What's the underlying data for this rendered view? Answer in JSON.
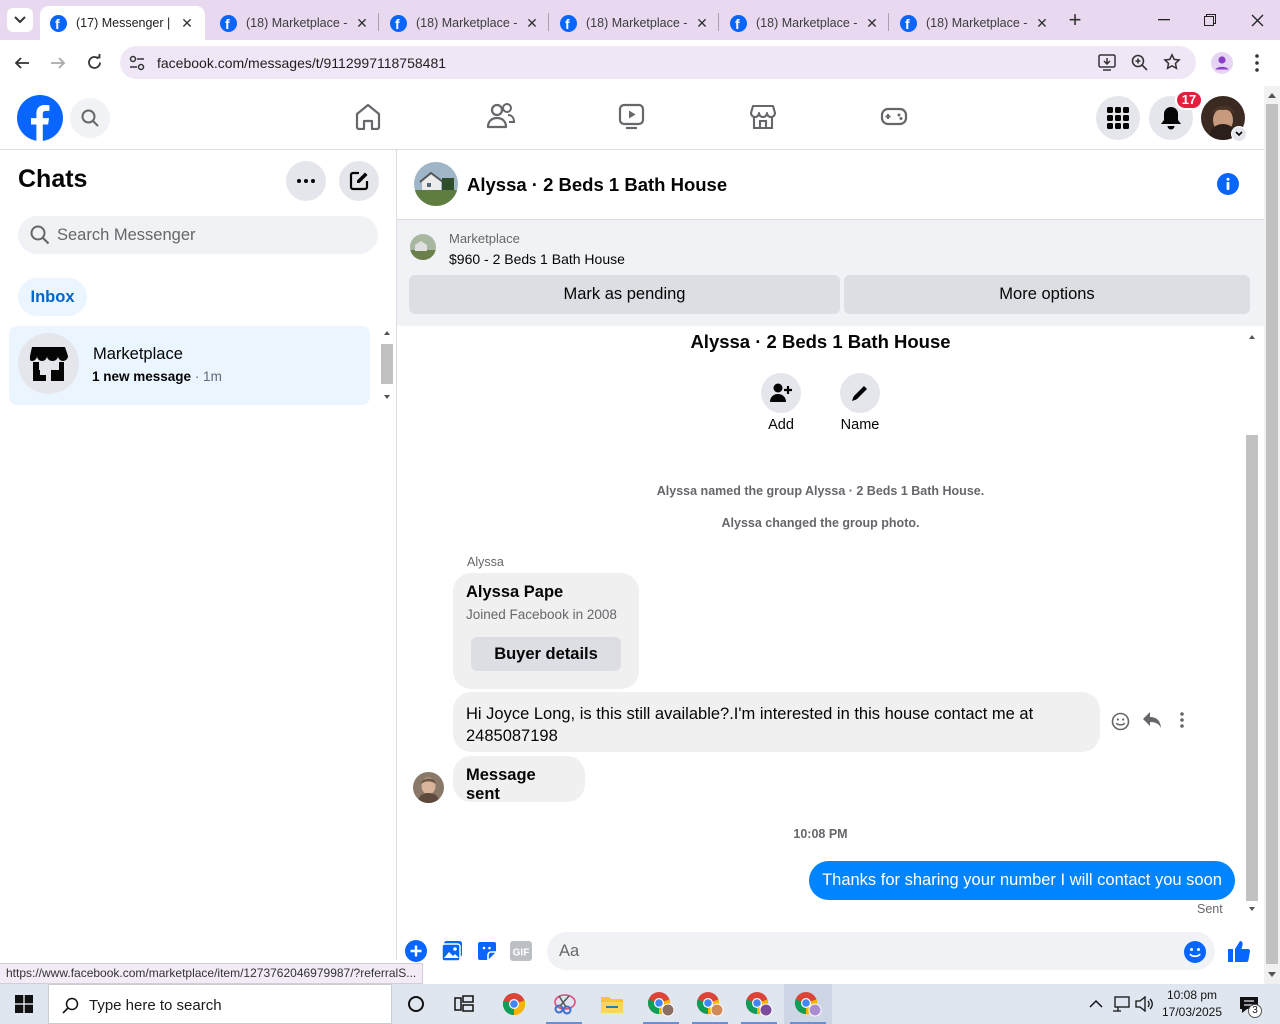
{
  "browser": {
    "tabs": [
      {
        "title": "(17) Messenger | Fa",
        "active": true
      },
      {
        "title": "(18) Marketplace -",
        "active": false
      },
      {
        "title": "(18) Marketplace -",
        "active": false
      },
      {
        "title": "(18) Marketplace -",
        "active": false
      },
      {
        "title": "(18) Marketplace -",
        "active": false
      },
      {
        "title": "(18) Marketplace -",
        "active": false
      }
    ],
    "favicon_letter": "f",
    "close_glyph": "✕",
    "new_tab_glyph": "+",
    "url": "facebook.com/messages/t/9112997118758481",
    "status_url": "https://www.facebook.com/marketplace/item/1273762046979987/?referralS..."
  },
  "fb_header": {
    "notification_count": "17",
    "nav_icons": [
      "home-icon",
      "friends-icon",
      "watch-icon",
      "marketplace-icon",
      "gaming-icon"
    ]
  },
  "chats": {
    "title": "Chats",
    "search_placeholder": "Search Messenger",
    "filter_label": "Inbox",
    "threads": [
      {
        "name": "Marketplace",
        "preview": "1 new message",
        "time": " · 1m"
      }
    ]
  },
  "conversation": {
    "title": "Alyssa · 2 Beds 1 Bath House",
    "marketplace_label": "Marketplace",
    "listing": "$960 - 2 Beds 1 Bath House",
    "mark_pending_label": "Mark as pending",
    "more_options_label": "More options",
    "group_title": "Alyssa · 2 Beds 1 Bath House",
    "add_label": "Add",
    "name_label": "Name",
    "system_messages": [
      "Alyssa named the group Alyssa · 2 Beds 1 Bath House.",
      "Alyssa changed the group photo."
    ],
    "sender_name": "Alyssa",
    "profile_card": {
      "name": "Alyssa Pape",
      "joined": "Joined Facebook in 2008",
      "button": "Buyer details"
    },
    "incoming_message": "Hi Joyce Long, is this still available?.I'm interested in this house contact me at 2485087198",
    "incoming_message_2": "Message sent",
    "timestamp": "10:08 PM",
    "outgoing_message": "Thanks for sharing your number I will contact you soon",
    "outgoing_status": "Sent",
    "composer_placeholder": "Aa"
  },
  "taskbar": {
    "search_placeholder": "Type here to search",
    "time": "10:08 pm",
    "date": "17/03/2025",
    "notification_count": "3"
  },
  "colors": {
    "accent": "#0866ff",
    "messenger_blue": "#0084ff",
    "notification_red": "#e41e3f",
    "inbox_bg": "#ebf5ff"
  }
}
